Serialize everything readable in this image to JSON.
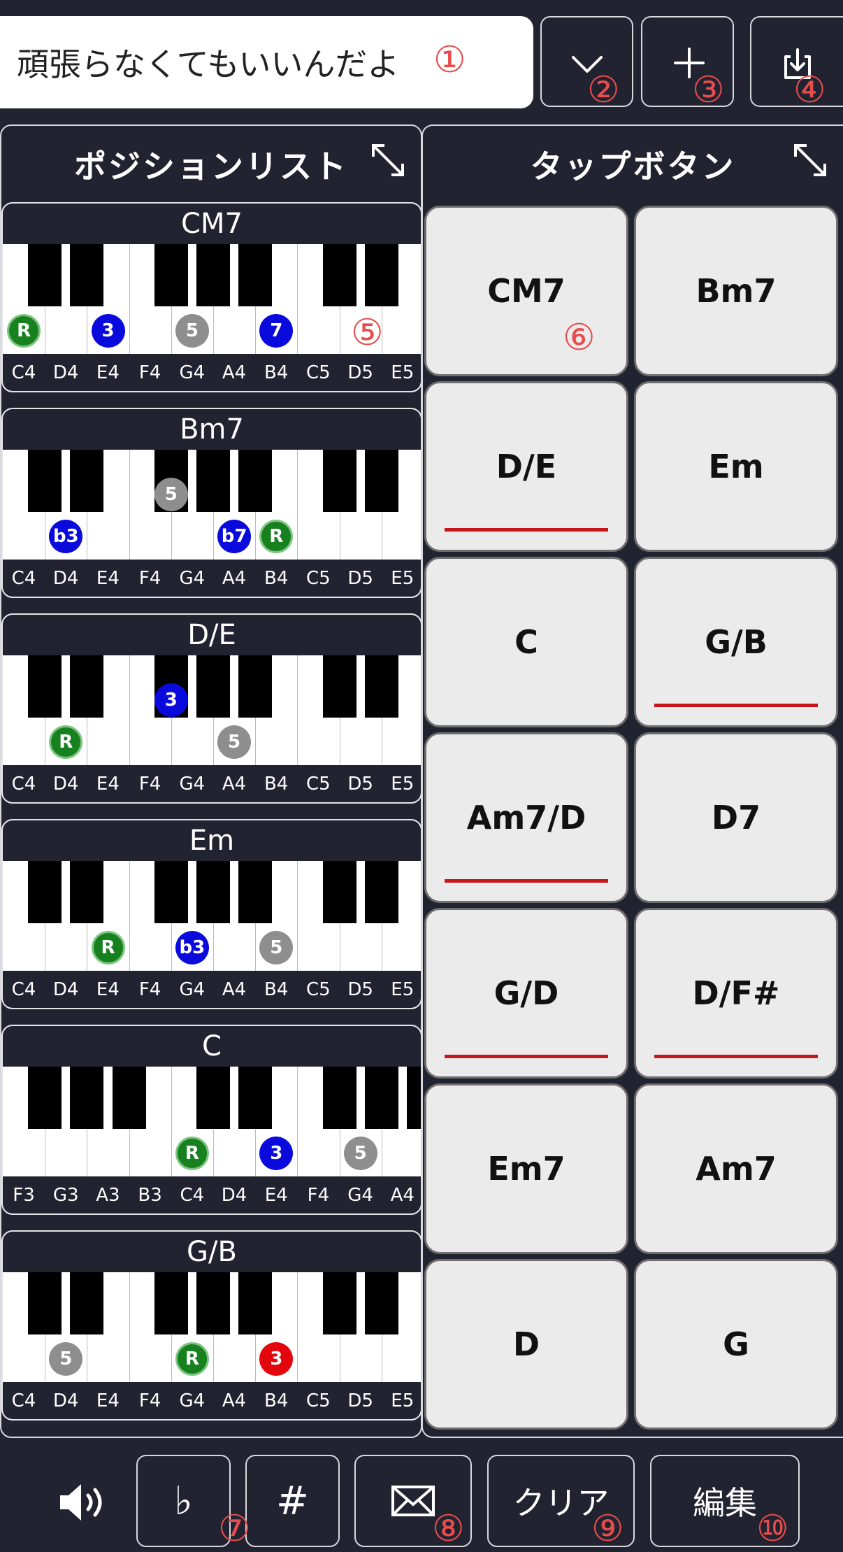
{
  "header": {
    "song_title": "頑張らなくてもいいんだよ",
    "dropdown_icon": "chevron-down-icon",
    "add_icon": "plus-icon",
    "save_icon": "save-download-icon"
  },
  "annotations": [
    "①",
    "②",
    "③",
    "④",
    "⑤",
    "⑥",
    "⑦",
    "⑧",
    "⑨",
    "⑩"
  ],
  "position_list": {
    "title": "ポジションリスト",
    "expand_icon": "expand-arrows-icon",
    "chords": [
      {
        "name": "CM7",
        "notes": [
          "C4",
          "D4",
          "E4",
          "F4",
          "G4",
          "A4",
          "B4",
          "C5",
          "D5",
          "E5"
        ],
        "dots": [
          {
            "key": "C4",
            "label": "R",
            "type": "root"
          },
          {
            "key": "E4",
            "label": "3",
            "type": "third"
          },
          {
            "key": "G4",
            "label": "5",
            "type": "fifth"
          },
          {
            "key": "B4",
            "label": "7",
            "type": "third"
          }
        ]
      },
      {
        "name": "Bm7",
        "notes": [
          "C4",
          "D4",
          "E4",
          "F4",
          "G4",
          "A4",
          "B4",
          "C5",
          "D5",
          "E5"
        ],
        "dots": [
          {
            "key": "D4",
            "label": "b3",
            "type": "third"
          },
          {
            "key": "F#4",
            "label": "5",
            "type": "fifth"
          },
          {
            "key": "A4",
            "label": "b7",
            "type": "third"
          },
          {
            "key": "B4",
            "label": "R",
            "type": "root"
          }
        ]
      },
      {
        "name": "D/E",
        "notes": [
          "C4",
          "D4",
          "E4",
          "F4",
          "G4",
          "A4",
          "B4",
          "C5",
          "D5",
          "E5"
        ],
        "dots": [
          {
            "key": "D4",
            "label": "R",
            "type": "root"
          },
          {
            "key": "F#4",
            "label": "3",
            "type": "third"
          },
          {
            "key": "A4",
            "label": "5",
            "type": "fifth"
          }
        ]
      },
      {
        "name": "Em",
        "notes": [
          "C4",
          "D4",
          "E4",
          "F4",
          "G4",
          "A4",
          "B4",
          "C5",
          "D5",
          "E5"
        ],
        "dots": [
          {
            "key": "E4",
            "label": "R",
            "type": "root"
          },
          {
            "key": "G4",
            "label": "b3",
            "type": "third"
          },
          {
            "key": "B4",
            "label": "5",
            "type": "fifth"
          }
        ]
      },
      {
        "name": "C",
        "notes": [
          "F3",
          "G3",
          "A3",
          "B3",
          "C4",
          "D4",
          "E4",
          "F4",
          "G4",
          "A4"
        ],
        "dots": [
          {
            "key": "C4",
            "label": "R",
            "type": "root"
          },
          {
            "key": "E4",
            "label": "3",
            "type": "third"
          },
          {
            "key": "G4",
            "label": "5",
            "type": "fifth"
          }
        ]
      },
      {
        "name": "G/B",
        "notes": [
          "C4",
          "D4",
          "E4",
          "F4",
          "G4",
          "A4",
          "B4",
          "C5",
          "D5",
          "E5"
        ],
        "dots": [
          {
            "key": "D4",
            "label": "5",
            "type": "fifth"
          },
          {
            "key": "G4",
            "label": "R",
            "type": "root"
          },
          {
            "key": "B4",
            "label": "3",
            "type": "bass"
          }
        ]
      }
    ]
  },
  "tap_panel": {
    "title": "タップボタン",
    "expand_icon": "expand-arrows-icon",
    "buttons": [
      {
        "label": "CM7",
        "underlined": false
      },
      {
        "label": "Bm7",
        "underlined": false
      },
      {
        "label": "D/E",
        "underlined": true
      },
      {
        "label": "Em",
        "underlined": false
      },
      {
        "label": "C",
        "underlined": false
      },
      {
        "label": "G/B",
        "underlined": true
      },
      {
        "label": "Am7/D",
        "underlined": true
      },
      {
        "label": "D7",
        "underlined": false
      },
      {
        "label": "G/D",
        "underlined": true
      },
      {
        "label": "D/F#",
        "underlined": true
      },
      {
        "label": "Em7",
        "underlined": false
      },
      {
        "label": "Am7",
        "underlined": false
      },
      {
        "label": "D",
        "underlined": false
      },
      {
        "label": "G",
        "underlined": false
      }
    ]
  },
  "bottom_bar": {
    "speaker_icon": "speaker-volume-icon",
    "flat_label": "♭",
    "sharp_label": "#",
    "mail_icon": "mail-envelope-icon",
    "clear_label": "クリア",
    "edit_label": "編集"
  },
  "colors": {
    "background": "#222331",
    "root_dot": "#17801f",
    "third_dot": "#0a0adc",
    "fifth_dot": "#8e8e8e",
    "bass_dot": "#e3060c",
    "underline": "#c8151b",
    "annotation": "#e84c4c"
  }
}
